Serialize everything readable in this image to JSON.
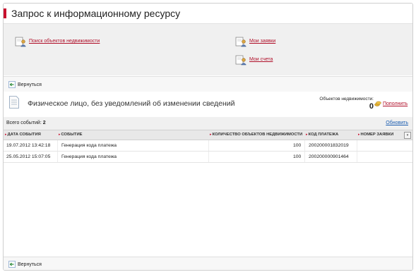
{
  "title": "Запрос к информационному ресурсу",
  "nav": {
    "search_objects": "Поиск объектов недвижимости",
    "my_requests": "Мои заявки",
    "my_accounts": "Мои счета"
  },
  "back_label": "Вернуться",
  "person": {
    "title": "Физическое лицо, без уведомлений об изменении сведений",
    "objects_label": "Объектов недвижимости:",
    "objects_count": "0",
    "replenish_label": "Пополнить"
  },
  "events": {
    "total_label": "Всего событий:",
    "total_value": "2",
    "refresh_label": "Обновить"
  },
  "table": {
    "columns": [
      "ДАТА СОБЫТИЯ",
      "СОБЫТИЕ",
      "КОЛИЧЕСТВО ОБЪЕКТОВ НЕДВИЖИМОСТИ",
      "КОД ПЛАТЕЖА",
      "НОМЕР ЗАЯВКИ"
    ],
    "rows": [
      {
        "date": "19.07.2012 13:42:18",
        "event": "Генерация кода платежа",
        "count": "100",
        "code": "200200001832019",
        "request": ""
      },
      {
        "date": "25.05.2012 15:07:05",
        "event": "Генерация кода платежа",
        "count": "100",
        "code": "200200000901464",
        "request": ""
      }
    ]
  },
  "colors": {
    "accent": "#c8102e",
    "link": "#b0102a",
    "refresh": "#1a5cb0"
  },
  "icons": {
    "nav": "person-document-icon",
    "back": "back-arrow-icon",
    "replenish": "coins-icon",
    "doc": "document-icon"
  }
}
